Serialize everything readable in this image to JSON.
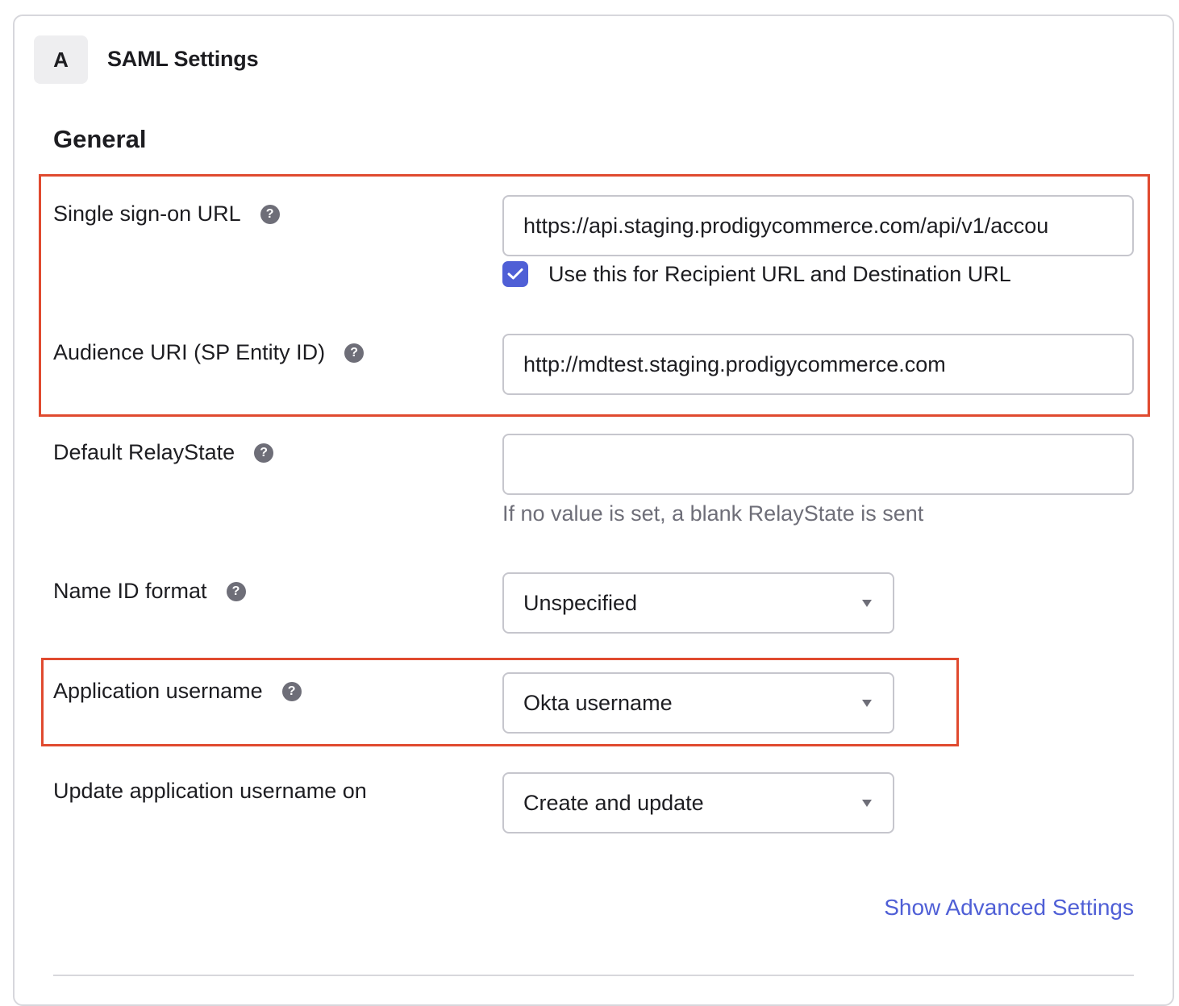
{
  "card": {
    "step": "A",
    "title": "SAML Settings"
  },
  "general": {
    "heading": "General",
    "sso_url": {
      "label": "Single sign-on URL",
      "value": "https://api.staging.prodigycommerce.com/api/v1/accou",
      "checkbox_label": "Use this for Recipient URL and Destination URL",
      "checkbox_checked": true
    },
    "audience_uri": {
      "label": "Audience URI (SP Entity ID)",
      "value": "http://mdtest.staging.prodigycommerce.com"
    },
    "relay_state": {
      "label": "Default RelayState",
      "value": "",
      "hint": "If no value is set, a blank RelayState is sent"
    },
    "name_id_format": {
      "label": "Name ID format",
      "selected": "Unspecified"
    },
    "app_username": {
      "label": "Application username",
      "selected": "Okta username"
    },
    "update_username_on": {
      "label": "Update application username on",
      "selected": "Create and update"
    },
    "advanced_link": "Show Advanced Settings"
  },
  "help_glyph": "?",
  "colors": {
    "accent": "#4f5fd6",
    "highlight": "#e04a2f",
    "help_icon": "#6e6e78"
  }
}
